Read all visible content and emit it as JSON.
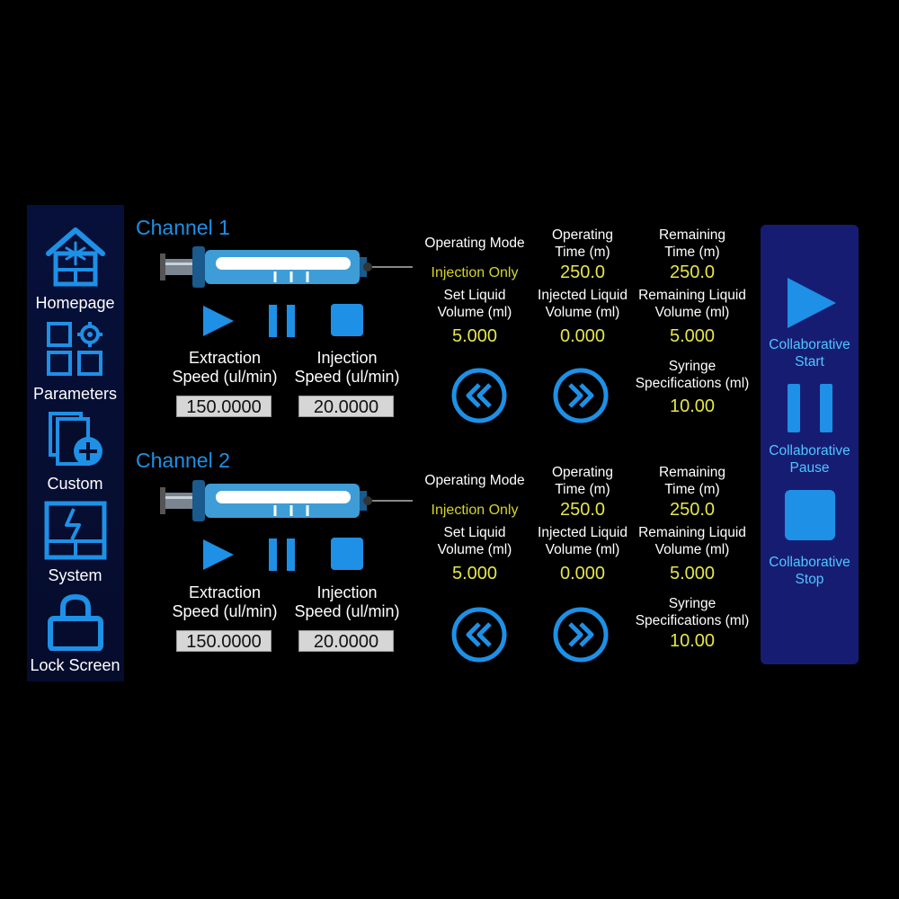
{
  "sidebar": {
    "items": [
      {
        "label": "Homepage",
        "icon": "home-snowflake-icon"
      },
      {
        "label": "Parameters",
        "icon": "parameters-grid-gear-icon"
      },
      {
        "label": "Custom",
        "icon": "custom-add-document-icon"
      },
      {
        "label": "System",
        "icon": "system-panel-icon"
      },
      {
        "label": "Lock Screen",
        "icon": "lock-icon"
      }
    ]
  },
  "channels": [
    {
      "title": "Channel 1",
      "extraction_label": [
        "Extraction",
        "Speed (ul/min)"
      ],
      "injection_label": [
        "Injection",
        "Speed (ul/min)"
      ],
      "extraction_speed": "150.0000",
      "injection_speed": "20.0000",
      "operating_mode_label": "Operating Mode",
      "operating_mode": "Injection Only",
      "operating_time_label": [
        "Operating",
        "Time (m)"
      ],
      "operating_time": "250.0",
      "remaining_time_label": [
        "Remaining",
        "Time (m)"
      ],
      "remaining_time": "250.0",
      "set_volume_label": [
        "Set Liquid",
        "Volume (ml)"
      ],
      "set_volume": "5.000",
      "injected_volume_label": [
        "Injected Liquid",
        "Volume (ml)"
      ],
      "injected_volume": "0.000",
      "remaining_volume_label": [
        "Remaining Liquid",
        "Volume (ml)"
      ],
      "remaining_volume": "5.000",
      "syringe_spec_label": [
        "Syringe",
        "Specifications (ml)"
      ],
      "syringe_spec": "10.00"
    },
    {
      "title": "Channel 2",
      "extraction_label": [
        "Extraction",
        "Speed (ul/min)"
      ],
      "injection_label": [
        "Injection",
        "Speed (ul/min)"
      ],
      "extraction_speed": "150.0000",
      "injection_speed": "20.0000",
      "operating_mode_label": "Operating Mode",
      "operating_mode": "Injection Only",
      "operating_time_label": [
        "Operating",
        "Time (m)"
      ],
      "operating_time": "250.0",
      "remaining_time_label": [
        "Remaining",
        "Time (m)"
      ],
      "remaining_time": "250.0",
      "set_volume_label": [
        "Set Liquid",
        "Volume (ml)"
      ],
      "set_volume": "5.000",
      "injected_volume_label": [
        "Injected Liquid",
        "Volume (ml)"
      ],
      "injected_volume": "0.000",
      "remaining_volume_label": [
        "Remaining Liquid",
        "Volume (ml)"
      ],
      "remaining_volume": "5.000",
      "syringe_spec_label": [
        "Syringe",
        "Specifications (ml)"
      ],
      "syringe_spec": "10.00"
    }
  ],
  "collaborative": {
    "start_label": [
      "Collaborative",
      "Start"
    ],
    "pause_label": [
      "Collaborative",
      "Pause"
    ],
    "stop_label": [
      "Collaborative",
      "Stop"
    ]
  },
  "colors": {
    "accent": "#1e90e6",
    "value_yellow": "#e6e64a",
    "collab_panel": "#171c73",
    "collab_text": "#4fc6ff"
  }
}
